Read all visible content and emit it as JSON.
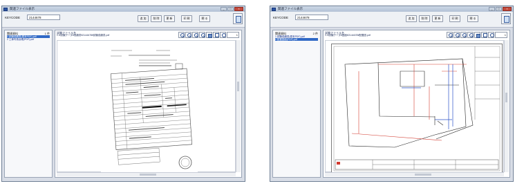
{
  "windows": [
    {
      "title": "関連ファイル表示",
      "toolbar": {
        "id_label": "KEYCODE",
        "id_value": "2144678",
        "buttons": [
          "追 加",
          "削 除",
          "更 新",
          "印 刷",
          "閉 る"
        ]
      },
      "sidebar": {
        "header_left": "関連資料",
        "header_right": "1 件",
        "items": [
          "1 試験成績書(原本PDF).pdf",
          "2 工事写真台帳(PDF).pdf"
        ],
        "selected": 0
      },
      "viewer": {
        "header": "試験ファイル名",
        "path": "C:¥試験データ¥成績書¥2144678¥試験成績書.pdf",
        "page": "1"
      },
      "document": "form"
    },
    {
      "title": "関連ファイル表示",
      "toolbar": {
        "id_label": "KEYCODE",
        "id_value": "2144678",
        "buttons": [
          "追 加",
          "削 除",
          "更 新",
          "印 刷",
          "閉 る"
        ]
      },
      "sidebar": {
        "header_left": "関連資料",
        "header_right": "2 件",
        "items": [
          "1 試験成績書(原本PDF).pdf",
          "2 配置図面(PDF).pdf"
        ],
        "selected": 1
      },
      "viewer": {
        "header": "試験ファイル名",
        "path": "C:¥試験データ¥図面¥2144678¥配置図.pdf",
        "page": "1"
      },
      "document": "drawing"
    }
  ],
  "colors": {
    "selection": "#3169c6",
    "drawing_red": "#d23a2f",
    "drawing_blue": "#2a52c8",
    "stamp": "#555555"
  }
}
